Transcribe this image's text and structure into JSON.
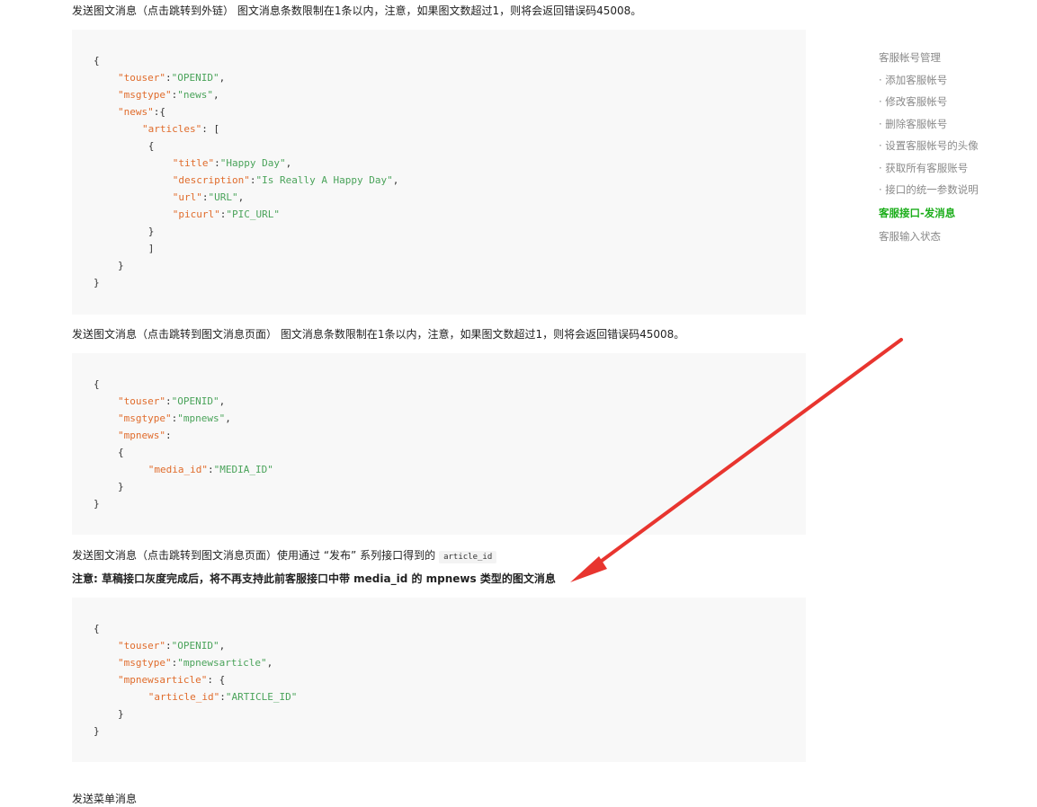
{
  "paragraphs": {
    "p1": "发送图文消息（点击跳转到外链） 图文消息条数限制在1条以内，注意，如果图文数超过1，则将会返回错误码45008。",
    "p2": "发送图文消息（点击跳转到图文消息页面） 图文消息条数限制在1条以内，注意，如果图文数超过1，则将会返回错误码45008。",
    "p3": "发送图文消息（点击跳转到图文消息页面）使用通过 “发布” 系列接口得到的",
    "p3_code": "article_id",
    "note": "注意: 草稿接口灰度完成后，将不再支持此前客服接口中带 media_id 的 mpnews 类型的图文消息",
    "p4": "发送菜单消息"
  },
  "code1": [
    {
      "indent": 0,
      "parts": [
        [
          "p",
          "{"
        ]
      ]
    },
    {
      "indent": 1,
      "parts": [
        [
          "k",
          "\"touser\""
        ],
        [
          "p",
          ":"
        ],
        [
          "s",
          "\"OPENID\""
        ],
        [
          "p",
          ","
        ]
      ]
    },
    {
      "indent": 1,
      "parts": [
        [
          "k",
          "\"msgtype\""
        ],
        [
          "p",
          ":"
        ],
        [
          "s",
          "\"news\""
        ],
        [
          "p",
          ","
        ]
      ]
    },
    {
      "indent": 1,
      "parts": [
        [
          "k",
          "\"news\""
        ],
        [
          "p",
          ":{"
        ]
      ]
    },
    {
      "indent": 2,
      "parts": [
        [
          "k",
          "\"articles\""
        ],
        [
          "p",
          ": ["
        ]
      ]
    },
    {
      "indent": 2.25,
      "parts": [
        [
          "p",
          "{"
        ]
      ]
    },
    {
      "indent": 3.25,
      "parts": [
        [
          "k",
          "\"title\""
        ],
        [
          "p",
          ":"
        ],
        [
          "s",
          "\"Happy Day\""
        ],
        [
          "p",
          ","
        ]
      ]
    },
    {
      "indent": 3.25,
      "parts": [
        [
          "k",
          "\"description\""
        ],
        [
          "p",
          ":"
        ],
        [
          "s",
          "\"Is Really A Happy Day\""
        ],
        [
          "p",
          ","
        ]
      ]
    },
    {
      "indent": 3.25,
      "parts": [
        [
          "k",
          "\"url\""
        ],
        [
          "p",
          ":"
        ],
        [
          "s",
          "\"URL\""
        ],
        [
          "p",
          ","
        ]
      ]
    },
    {
      "indent": 3.25,
      "parts": [
        [
          "k",
          "\"picurl\""
        ],
        [
          "p",
          ":"
        ],
        [
          "s",
          "\"PIC_URL\""
        ]
      ]
    },
    {
      "indent": 2.25,
      "parts": [
        [
          "p",
          "}"
        ]
      ]
    },
    {
      "indent": 2.25,
      "parts": [
        [
          "p",
          "]"
        ]
      ]
    },
    {
      "indent": 1,
      "parts": [
        [
          "p",
          "}"
        ]
      ]
    },
    {
      "indent": 0,
      "parts": [
        [
          "p",
          "}"
        ]
      ]
    }
  ],
  "code2": [
    {
      "indent": 0,
      "parts": [
        [
          "p",
          "{"
        ]
      ]
    },
    {
      "indent": 1,
      "parts": [
        [
          "k",
          "\"touser\""
        ],
        [
          "p",
          ":"
        ],
        [
          "s",
          "\"OPENID\""
        ],
        [
          "p",
          ","
        ]
      ]
    },
    {
      "indent": 1,
      "parts": [
        [
          "k",
          "\"msgtype\""
        ],
        [
          "p",
          ":"
        ],
        [
          "s",
          "\"mpnews\""
        ],
        [
          "p",
          ","
        ]
      ]
    },
    {
      "indent": 1,
      "parts": [
        [
          "k",
          "\"mpnews\""
        ],
        [
          "p",
          ":"
        ]
      ]
    },
    {
      "indent": 1,
      "parts": [
        [
          "p",
          "{"
        ]
      ]
    },
    {
      "indent": 2.25,
      "parts": [
        [
          "k",
          "\"media_id\""
        ],
        [
          "p",
          ":"
        ],
        [
          "s",
          "\"MEDIA_ID\""
        ]
      ]
    },
    {
      "indent": 1,
      "parts": [
        [
          "p",
          "}"
        ]
      ]
    },
    {
      "indent": 0,
      "parts": [
        [
          "p",
          "}"
        ]
      ]
    }
  ],
  "code3": [
    {
      "indent": 0,
      "parts": [
        [
          "p",
          "{"
        ]
      ]
    },
    {
      "indent": 1,
      "parts": [
        [
          "k",
          "\"touser\""
        ],
        [
          "p",
          ":"
        ],
        [
          "s",
          "\"OPENID\""
        ],
        [
          "p",
          ","
        ]
      ]
    },
    {
      "indent": 1,
      "parts": [
        [
          "k",
          "\"msgtype\""
        ],
        [
          "p",
          ":"
        ],
        [
          "s",
          "\"mpnewsarticle\""
        ],
        [
          "p",
          ","
        ]
      ]
    },
    {
      "indent": 1,
      "parts": [
        [
          "k",
          "\"mpnewsarticle\""
        ],
        [
          "p",
          ": {"
        ]
      ]
    },
    {
      "indent": 2.25,
      "parts": [
        [
          "k",
          "\"article_id\""
        ],
        [
          "p",
          ":"
        ],
        [
          "s",
          "\"ARTICLE_ID\""
        ]
      ]
    },
    {
      "indent": 1,
      "parts": [
        [
          "p",
          "}"
        ]
      ]
    },
    {
      "indent": 0,
      "parts": [
        [
          "p",
          "}"
        ]
      ]
    }
  ],
  "toc": [
    {
      "label": "客服帐号管理",
      "kind": "section"
    },
    {
      "label": "· 添加客服帐号",
      "kind": "sub"
    },
    {
      "label": "· 修改客服帐号",
      "kind": "sub"
    },
    {
      "label": "· 删除客服帐号",
      "kind": "sub"
    },
    {
      "label": "· 设置客服帐号的头像",
      "kind": "sub"
    },
    {
      "label": "· 获取所有客服账号",
      "kind": "sub"
    },
    {
      "label": "· 接口的统一参数说明",
      "kind": "sub"
    },
    {
      "label": "客服接口-发消息",
      "kind": "active"
    },
    {
      "label": "客服输入状态",
      "kind": "section"
    }
  ],
  "colors": {
    "key": "#e06c2c",
    "string": "#4aa35a",
    "active_link": "#1aad19",
    "arrow": "#e8352f"
  }
}
